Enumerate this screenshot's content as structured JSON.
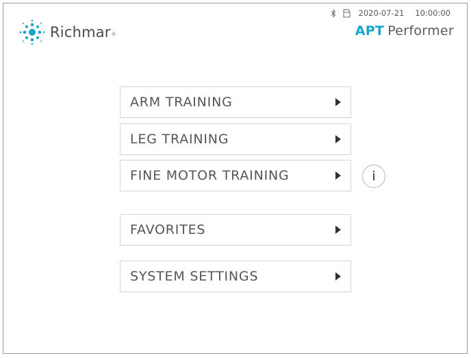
{
  "header": {
    "brand_name": "Richmar",
    "brand_reg": "®",
    "product_prefix": "APT",
    "product_suffix": "Performer",
    "accent_color": "#1aa3d0"
  },
  "status": {
    "bluetooth_icon": "bluetooth-icon",
    "storage_icon": "sd-card-icon",
    "date": "2020-07-21",
    "time": "10:00:00"
  },
  "menu": {
    "items": [
      {
        "label": "ARM TRAINING"
      },
      {
        "label": "LEG TRAINING"
      },
      {
        "label": "FINE MOTOR TRAINING"
      },
      {
        "label": "FAVORITES"
      },
      {
        "label": "SYSTEM SETTINGS"
      }
    ],
    "info_label": "i"
  }
}
